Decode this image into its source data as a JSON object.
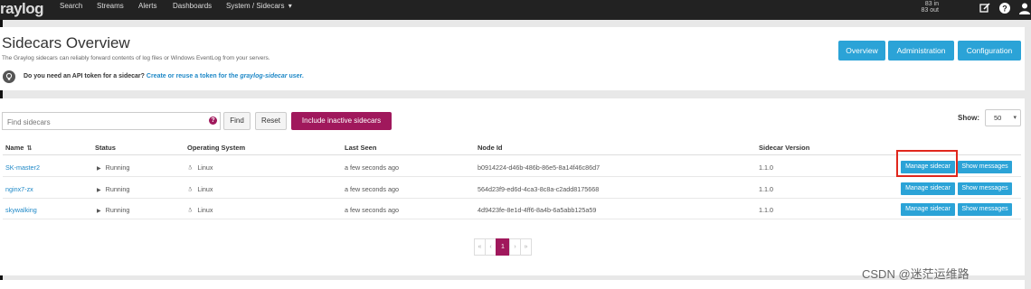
{
  "nav": {
    "logo": "raylog",
    "items": [
      "Search",
      "Streams",
      "Alerts",
      "Dashboards",
      "System / Sidecars"
    ],
    "dropdown_caret": "▾",
    "throughput_in": "83 in",
    "throughput_out": "83 out",
    "icons": [
      "edit-icon",
      "help-icon",
      "user-icon"
    ]
  },
  "header": {
    "title": "Sidecars Overview",
    "description": "The Graylog sidecars can reliably forward contents of log files or Windows EventLog from your servers.",
    "api_question": "Do you need an API token for a sidecar?",
    "api_link_pre": "Create or reuse a token for the ",
    "api_link_user": "graylog-sidecar",
    "api_link_post": " user.",
    "buttons": [
      "Overview",
      "Administration",
      "Configuration"
    ]
  },
  "search": {
    "placeholder": "Find sidecars",
    "help": "?",
    "find": "Find",
    "reset": "Reset",
    "include_inactive": "Include inactive sidecars",
    "show_label": "Show:",
    "show_value": "50"
  },
  "table": {
    "headers": [
      "Name",
      "Status",
      "Operating System",
      "Last Seen",
      "Node Id",
      "Sidecar Version"
    ],
    "rows": [
      {
        "name": "SK-master2",
        "status": "Running",
        "os": "Linux",
        "last_seen": "a few seconds ago",
        "node_id": "b0914224-d46b-486b-86e5-8a14f46c86d7",
        "version": "1.1.0"
      },
      {
        "name": "nginx7-zx",
        "status": "Running",
        "os": "Linux",
        "last_seen": "a few seconds ago",
        "node_id": "564d23f9-ed6d-4ca3-8c8a-c2add8175668",
        "version": "1.1.0"
      },
      {
        "name": "skywalking",
        "status": "Running",
        "os": "Linux",
        "last_seen": "a few seconds ago",
        "node_id": "4d9423fe-8e1d-4ff6-8a4b-6a5abb125a59",
        "version": "1.1.0"
      }
    ],
    "manage_label": "Manage sidecar",
    "messages_label": "Show messages"
  },
  "pagination": {
    "first": "«",
    "prev": "‹",
    "current": "1",
    "next": "›",
    "last": "»"
  },
  "watermark": "CSDN @迷茫运维路",
  "colors": {
    "accent": "#2ba3d7",
    "brand": "#a0185c",
    "highlight": "#e0271d"
  }
}
